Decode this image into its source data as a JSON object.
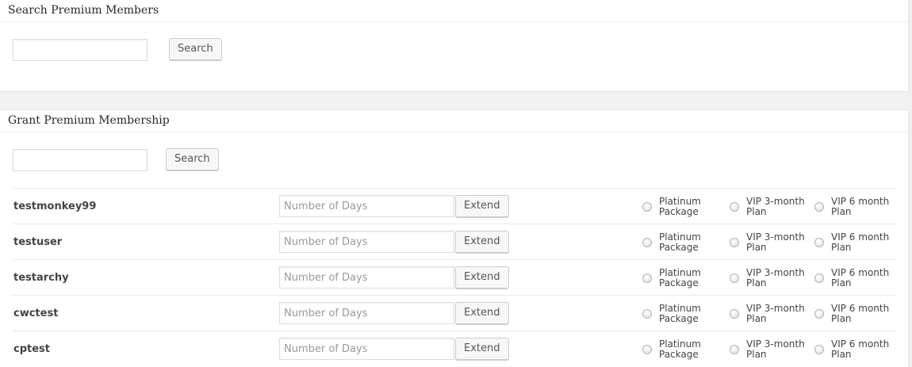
{
  "search_panel": {
    "title": "Search Premium Members",
    "input_value": "",
    "button_label": "Search"
  },
  "grant_panel": {
    "title": "Grant Premium Membership",
    "input_value": "",
    "button_label": "Search",
    "days_placeholder": "Number of Days",
    "extend_label": "Extend",
    "plans": [
      "Platinum Package",
      "VIP 3-month Plan",
      "VIP 6 month Plan"
    ],
    "members": [
      {
        "username": "testmonkey99"
      },
      {
        "username": "testuser"
      },
      {
        "username": "testarchy"
      },
      {
        "username": "cwctest"
      },
      {
        "username": "cptest"
      }
    ]
  }
}
